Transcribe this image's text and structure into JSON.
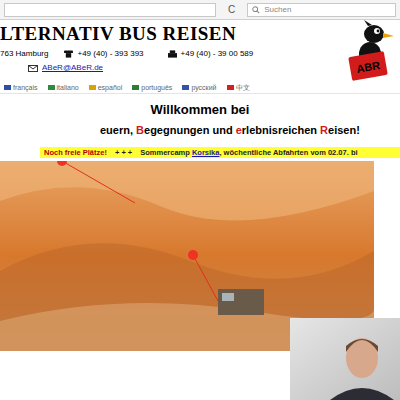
{
  "browser": {
    "reload": "C",
    "search_placeholder": "Suchen"
  },
  "header": {
    "title": "LTERNATIV BUS REISEN",
    "logo_text": "ABR",
    "address": "763 Hamburg",
    "phone": "+49 (40) - 393 393",
    "fax": "+49 (40) - 39 00 589",
    "email": "ABeR@ABeR.de"
  },
  "languages": [
    {
      "label": "français",
      "color": "#2b4fa8"
    },
    {
      "label": "italiano",
      "color": "#2e8b3d"
    },
    {
      "label": "español",
      "color": "#d9a300"
    },
    {
      "label": "português",
      "color": "#2e7d32"
    },
    {
      "label": "русский",
      "color": "#3353a8"
    },
    {
      "label": "中文",
      "color": "#d32020"
    }
  ],
  "welcome": {
    "line1": "Willkommen bei",
    "line2": [
      {
        "text": "euern, ",
        "color": "#000000"
      },
      {
        "text": "B",
        "color": "#d11a1a"
      },
      {
        "text": "egegnungen und ",
        "color": "#000000"
      },
      {
        "text": "e",
        "color": "#d11a1a"
      },
      {
        "text": "rlebnisreichen ",
        "color": "#000000"
      },
      {
        "text": "R",
        "color": "#d11a1a"
      },
      {
        "text": "eisen!",
        "color": "#000000"
      }
    ]
  },
  "banner": {
    "highlight": "Noch freie Plätze!",
    "separator": "+ + +",
    "before_link": "Sommercamp ",
    "link": "Korsika",
    "after_link": ", wöchentliche Abfahrten vom 02.07. bi"
  }
}
